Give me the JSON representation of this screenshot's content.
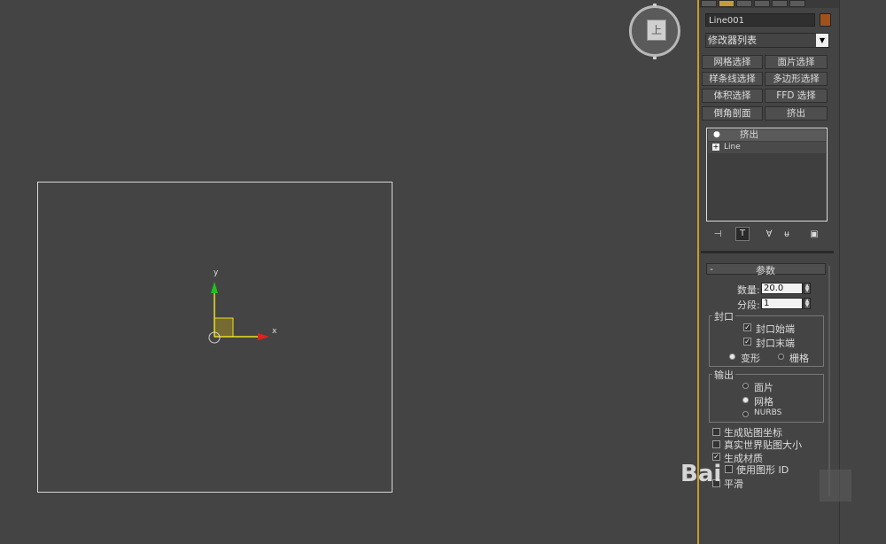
{
  "viewport": {
    "axis_y_label": "y",
    "axis_x_label": "x",
    "viewcube_face": "上"
  },
  "colors": {
    "accent_border": "#c89a2a",
    "object_color": "#a0521c",
    "axis_x": "#e02020",
    "axis_y": "#20c020"
  },
  "command_panel": {
    "tabs": [
      "create-icon",
      "modify-icon",
      "hierarchy-icon",
      "motion-icon",
      "display-icon",
      "utilities-icon"
    ],
    "object_name": "Line001",
    "modifier_list": "修改器列表",
    "modifier_buttons": [
      [
        "网格选择",
        "面片选择"
      ],
      [
        "样条线选择",
        "多边形选择"
      ],
      [
        "体积选择",
        "FFD 选择"
      ],
      [
        "倒角剖面",
        "挤出"
      ]
    ],
    "stack": {
      "row1_icon": "lightbulb-icon",
      "row1": "挤出",
      "row2_icon": "plus-icon",
      "row2": "Line"
    },
    "tools": [
      "pin-stack-icon",
      "show-end-result-icon",
      "make-unique-icon",
      "remove-modifier-icon",
      "configure-sets-icon"
    ]
  },
  "params": {
    "rollout_toggle": "-",
    "rollout_title": "参数",
    "amount_label": "数量:",
    "amount_value": "20.0",
    "segments_label": "分段:",
    "segments_value": "1",
    "capping_title": "封口",
    "cap_start": "封口始端",
    "cap_end": "封口末端",
    "morph": "变形",
    "grid": "栅格",
    "output_title": "输出",
    "patch": "面片",
    "mesh": "网格",
    "nurbs": "NURBS",
    "gen_map_coords": "生成贴图坐标",
    "real_world_map": "真实世界贴图大小",
    "gen_mat_ids": "生成材质",
    "use_shape_ids": "使用图形 ID",
    "smooth": "平滑"
  },
  "watermark": "Bai"
}
